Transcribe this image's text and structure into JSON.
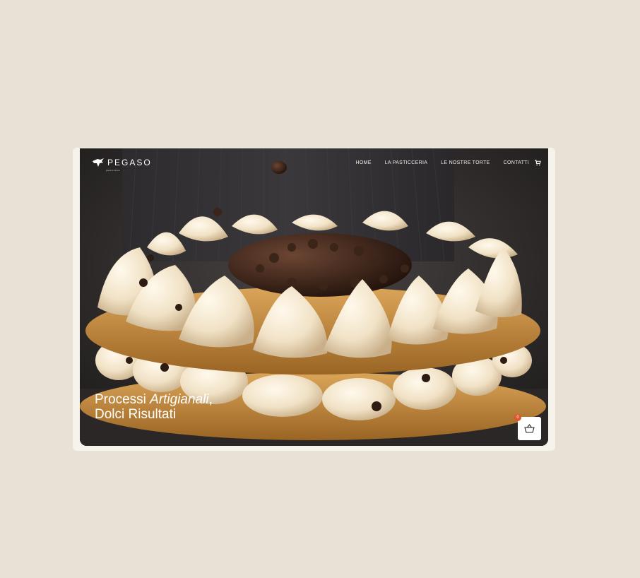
{
  "brand": {
    "name": "PEGASO",
    "tagline": "pasticceria",
    "logo_icon": "pegasus-icon"
  },
  "nav": {
    "items": [
      {
        "label": "HOME"
      },
      {
        "label": "LA PASTICCERIA"
      },
      {
        "label": "LE NOSTRE TORTE"
      },
      {
        "label": "CONTATTI"
      }
    ],
    "cart_icon": "cart-icon"
  },
  "hero": {
    "headline_part1": "Processi ",
    "headline_italic": "Artigianali",
    "headline_part2": ",",
    "headline_line2": "Dolci Risultati"
  },
  "basket": {
    "icon": "basket-icon",
    "count": "0"
  },
  "colors": {
    "background": "#e9e1d5",
    "badge": "#e0552d",
    "cream": "#f3e6cc",
    "pastry": "#c98a3c",
    "chocolate": "#3a2418"
  }
}
